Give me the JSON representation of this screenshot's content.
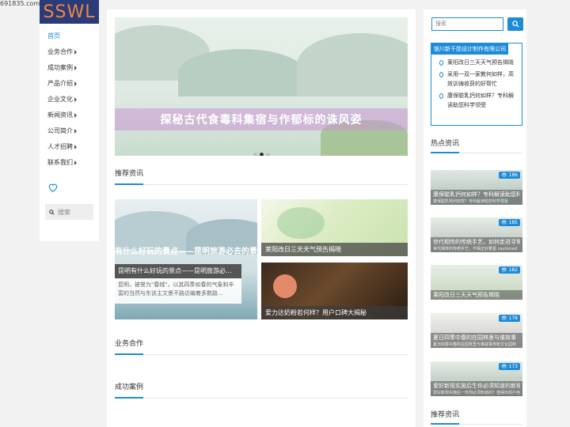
{
  "site": {
    "domain": "691835.com",
    "logo_text": "SSWL"
  },
  "nav": {
    "items": [
      {
        "label": "首页",
        "active": true,
        "arrow": false
      },
      {
        "label": "业务合作",
        "arrow": true
      },
      {
        "label": "成功案例",
        "arrow": true
      },
      {
        "label": "产品介绍",
        "arrow": true
      },
      {
        "label": "企业文化",
        "arrow": true
      },
      {
        "label": "新闻资讯",
        "arrow": true
      },
      {
        "label": "公司简介",
        "arrow": true
      },
      {
        "label": "人才招聘",
        "arrow": true
      },
      {
        "label": "联系我们",
        "arrow": true
      }
    ],
    "search_placeholder": "搜索"
  },
  "banner": {
    "title": "探秘古代食毒科集宿与作郁标的诛风姿",
    "slide_count": 3,
    "active_slide": 2
  },
  "sections": {
    "recommended": "推荐资讯",
    "business": "业务合作",
    "cases": "成功案例"
  },
  "featured": {
    "ghost_title": "有什么好玩的景点——昆明旅游必去的景点",
    "title": "昆明有什么好玩的景点——昆明旅游必...",
    "excerpt": "昆明，被誉为\"春城\"，以其四季如春的气象和丰富的当然与东该主文景不路访编着多数路..."
  },
  "small_cards": [
    {
      "caption": "莱阳改日三天天气预告揭晓"
    },
    {
      "caption": "爱力达奶粉若何样？用户口碑大揭秘"
    }
  ],
  "right": {
    "search_placeholder": "搜索",
    "company": "银川新千勋设计制作有限公司",
    "links": [
      "莱阳改日三天天气预告揭晓",
      "采用一双一家教何如样，高效训诲收获的好帮忙",
      "康保聪乳钙何如样？专科解读助您科学领受"
    ],
    "hot_title": "热点资讯",
    "recommend_title": "推荐资讯",
    "hot_items": [
      {
        "views": "186",
        "title": "康保聪乳钙何如样？专科解读助您科学",
        "sub": "康保聪乳钙何如样？专科解读助您科学领受"
      },
      {
        "views": "185",
        "title": "世代相传的传统手艺，如何走进寻常",
        "sub": "世代相传的传统手艺，不竭正好着墨 cautioned"
      },
      {
        "views": "182",
        "title": "莱阳改日三天天气预告揭晓",
        "sub": ""
      },
      {
        "views": "178",
        "title": "夏日四季中春的在园林里与谁故事",
        "sub": "夏日四季中春的在园林里与谁故事传统文化园林"
      },
      {
        "views": "173",
        "title": "爱好新规实施后生你必须知道的新规",
        "sub": "爱好新规实施后一份你必须知道的？值得出现户用变化留意"
      }
    ]
  }
}
